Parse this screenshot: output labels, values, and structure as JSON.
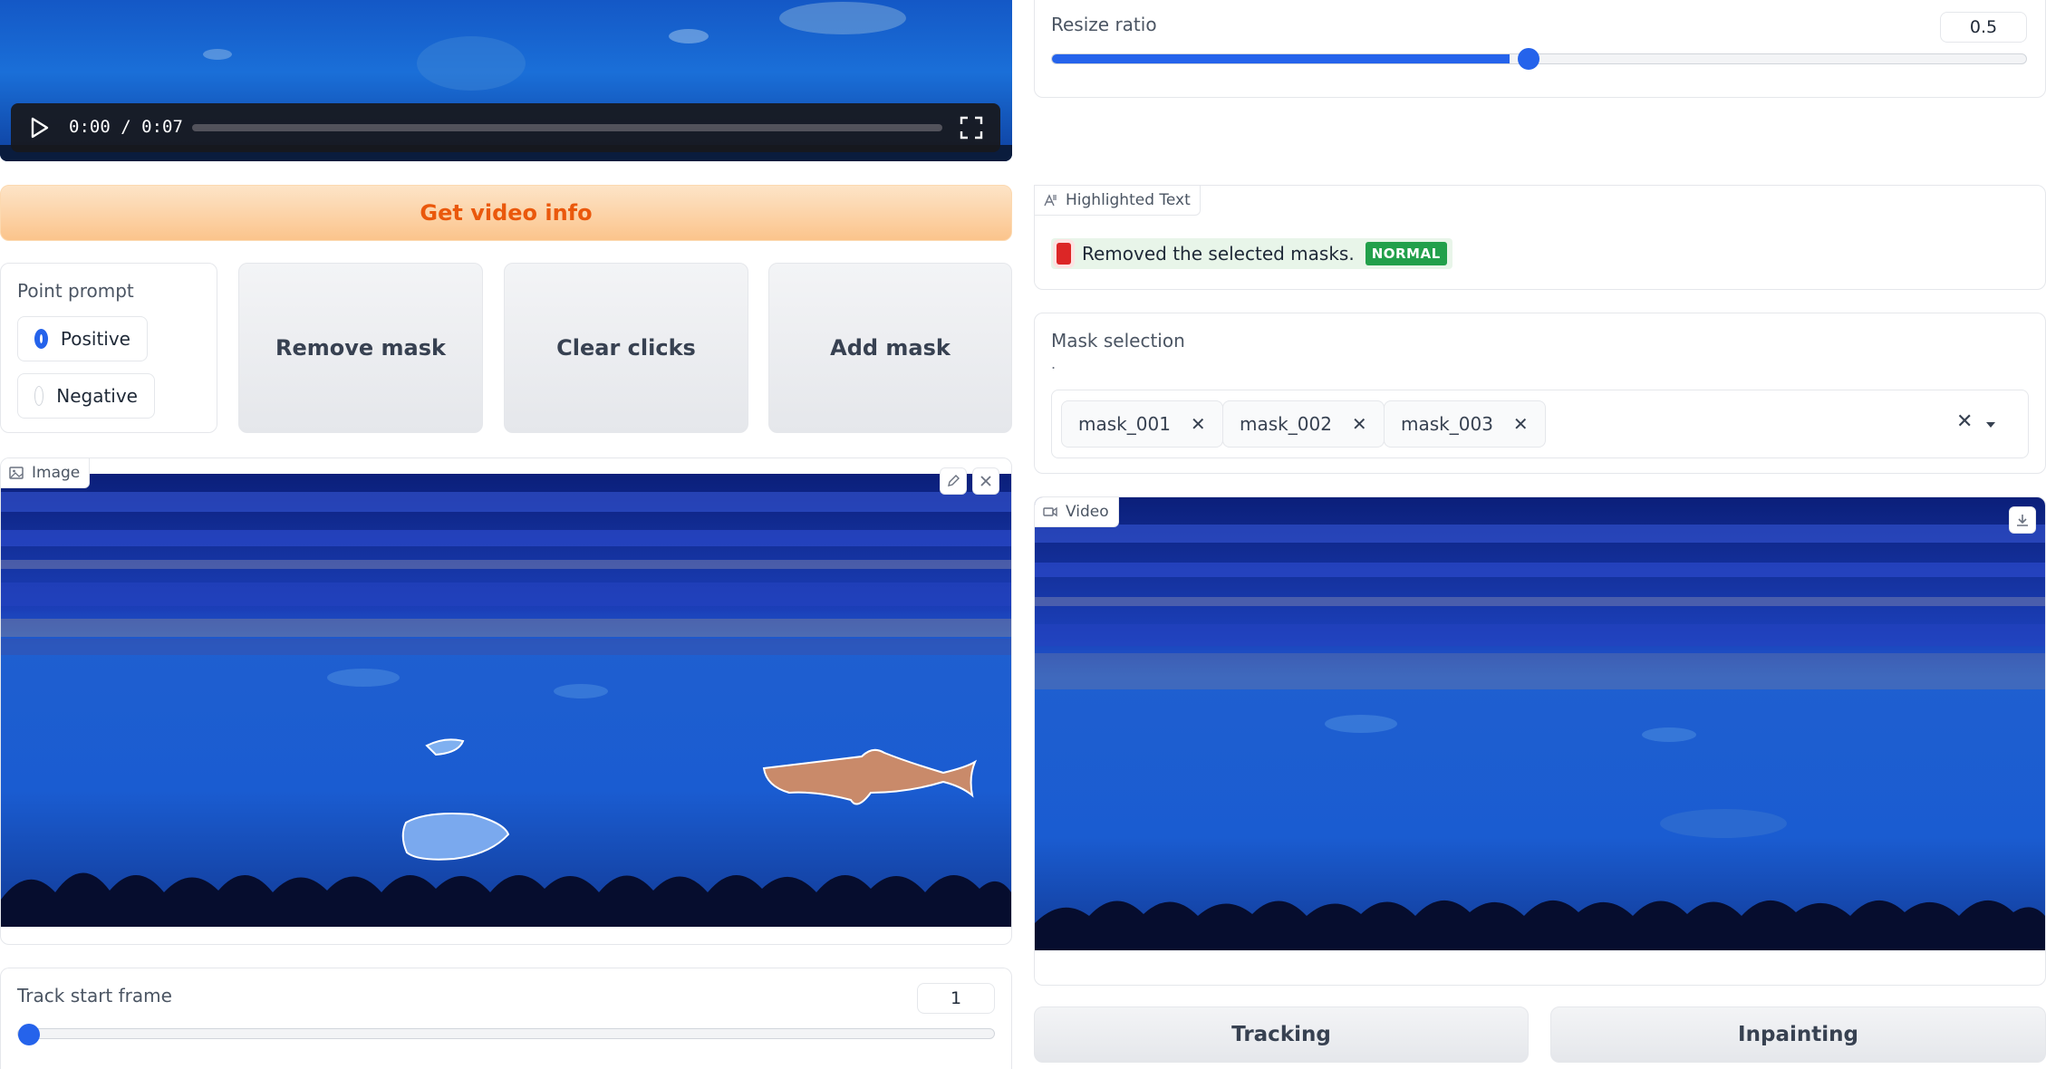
{
  "video_player": {
    "time_current": "0:00",
    "time_separator": "/",
    "time_total": "0:07",
    "progress": 0
  },
  "get_video_info": {
    "label": "Get video info"
  },
  "point_prompt": {
    "label": "Point prompt",
    "options": [
      {
        "label": "Positive",
        "selected": true
      },
      {
        "label": "Negative",
        "selected": false
      }
    ]
  },
  "actions": {
    "remove_mask": "Remove mask",
    "clear_clicks": "Clear clicks",
    "add_mask": "Add mask"
  },
  "image_panel": {
    "tag": "Image"
  },
  "track_start": {
    "label": "Track start frame",
    "value": "1",
    "fraction": 0
  },
  "resize_ratio": {
    "label": "Resize ratio",
    "value": "0.5",
    "fraction": 0.47
  },
  "highlighted_text": {
    "tag": "Highlighted Text",
    "message": "Removed the selected masks.",
    "badge": "NORMAL"
  },
  "mask_selection": {
    "label": "Mask selection",
    "info": ".",
    "chips": [
      "mask_001",
      "mask_002",
      "mask_003"
    ]
  },
  "video_panel": {
    "tag": "Video"
  },
  "bottom_buttons": {
    "tracking": "Tracking",
    "inpainting": "Inpainting"
  },
  "colors": {
    "accent_blue": "#2563eb",
    "orange_button": "#fbbf84",
    "orange_text": "#ea580c",
    "badge_green": "#22c55e"
  }
}
